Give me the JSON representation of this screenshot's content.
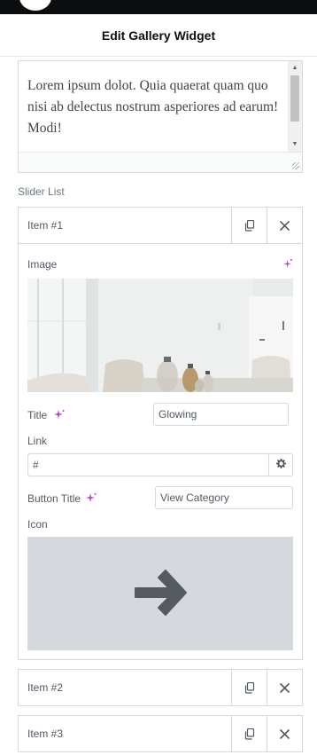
{
  "header": {
    "title": "Edit Gallery Widget"
  },
  "editor": {
    "text": "Lorem ipsum dolot. Quia quaerat quam quo nisi ab delectus nostrum asperiores ad earum! Modi!"
  },
  "slider_list": {
    "label": "Slider List",
    "items": [
      {
        "label": "Item #1",
        "fields": {
          "image_label": "Image",
          "title_label": "Title",
          "title_value": "Glowing",
          "link_label": "Link",
          "link_value": "#",
          "button_title_label": "Button Title",
          "button_title_value": "View Category",
          "icon_label": "Icon"
        }
      },
      {
        "label": "Item #2"
      },
      {
        "label": "Item #3"
      }
    ]
  },
  "icons": {
    "copy": "copy-icon",
    "close": "close-icon",
    "ai": "sparkle-icon",
    "settings": "gear-icon",
    "selected_icon": "arrow-right-icon"
  },
  "colors": {
    "ai_accent": "#c13bd2",
    "icon_preview_bg": "#d5d8dc",
    "icon_preview_fg": "#555a60"
  }
}
